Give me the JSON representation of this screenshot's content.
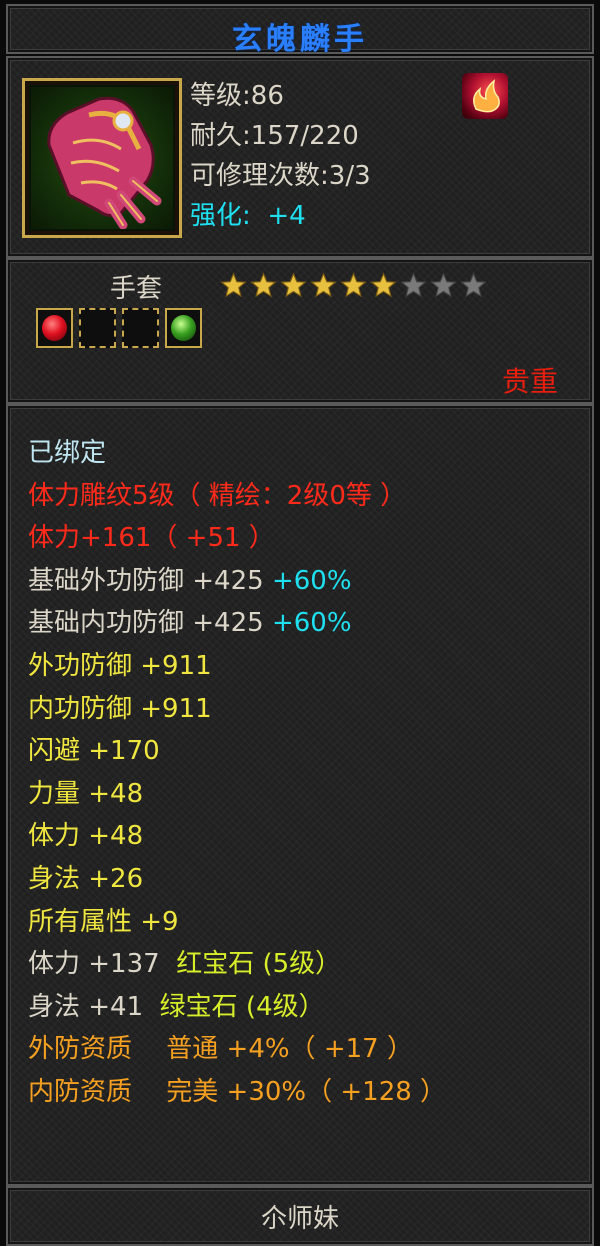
{
  "item": {
    "name": "玄魄麟手",
    "type": "手套",
    "rarity": "贵重",
    "level_label": "等级",
    "level_value": "86",
    "durability_label": "耐久",
    "durability_value": "157/220",
    "repair_label": "可修理次数",
    "repair_value": "3/3",
    "enhance_label": "强化",
    "enhance_value": "+4",
    "stars_filled": 6,
    "stars_total": 9,
    "sockets": [
      "red-gem",
      "empty",
      "empty",
      "green-gem"
    ],
    "portrait_icon": "gauntlet-icon",
    "corner_icon": "flame-emblem-icon"
  },
  "attributes": {
    "bound": "已绑定",
    "engrave": "体力雕纹5级（ 精绘：2级0等 ）",
    "stamina_main": "体力+161（ +51 ）",
    "base_ext_def": "基础外功防御 +425",
    "base_ext_def_pct": "+60%",
    "base_int_def": "基础内功防御 +425",
    "base_int_def_pct": "+60%",
    "ext_def": "外功防御 +911",
    "int_def": "内功防御 +911",
    "dodge": "闪避 +170",
    "strength": "力量 +48",
    "stamina": "体力 +48",
    "agility": "身法 +26",
    "all_attr": "所有属性 +9",
    "gem1_stat": "体力 +137",
    "gem1_name": "红宝石 (5级）",
    "gem2_stat": "身法 +41",
    "gem2_name": "绿宝石 (4级）",
    "ext_quality": "外防资质　 普通 +4%（ +17 ）",
    "int_quality": "内防资质　 完美 +30%（ +128 ）"
  },
  "footer": {
    "owner": "尒师妹"
  },
  "colors": {
    "title": "#2a7fff",
    "rarity": "#e81e0e",
    "enhance": "#1ee0f0",
    "star_gold": "#e8c040",
    "star_gray": "#7a7a7a"
  }
}
